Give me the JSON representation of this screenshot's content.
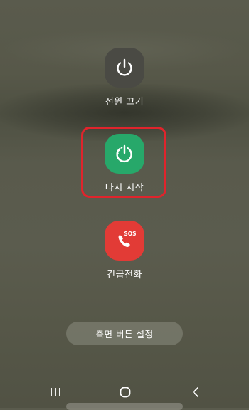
{
  "power_menu": {
    "power_off": {
      "label": "전원 끄기",
      "icon": "power-icon"
    },
    "restart": {
      "label": "다시 시작",
      "icon": "restart-icon"
    },
    "emergency_call": {
      "label": "긴급전화",
      "icon": "sos-phone-icon",
      "badge": "SOS"
    }
  },
  "side_key_settings": {
    "label": "측면 버튼 설정"
  },
  "navbar": {
    "recents_icon": "recents-icon",
    "home_icon": "home-icon",
    "back_icon": "back-icon"
  },
  "colors": {
    "restart_accent": "#27a86a",
    "emergency_accent": "#e23b36",
    "highlight": "#e0242c"
  }
}
